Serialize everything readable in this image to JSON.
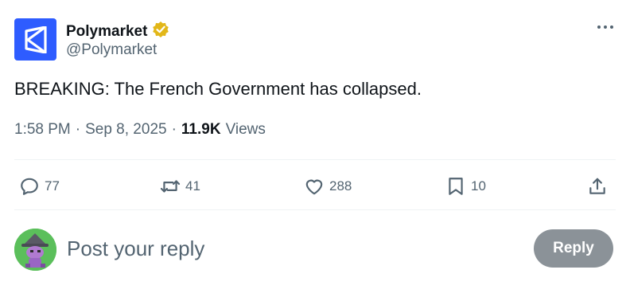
{
  "author": {
    "display_name": "Polymarket",
    "handle": "@Polymarket",
    "verified": true,
    "logo_color": "#2e5cff"
  },
  "tweet": {
    "text": "BREAKING: The French Government has collapsed.",
    "time": "1:58 PM",
    "date": "Sep 8, 2025",
    "views_count": "11.9K",
    "views_label": "Views",
    "separator": "·"
  },
  "actions": {
    "replies": "77",
    "retweets": "41",
    "likes": "288",
    "bookmarks": "10"
  },
  "reply_box": {
    "placeholder": "Post your reply",
    "button_label": "Reply"
  },
  "icons": [
    "polymarket-logo-icon",
    "verified-badge-icon",
    "more-icon",
    "reply-icon",
    "retweet-icon",
    "like-icon",
    "bookmark-icon",
    "share-icon"
  ]
}
